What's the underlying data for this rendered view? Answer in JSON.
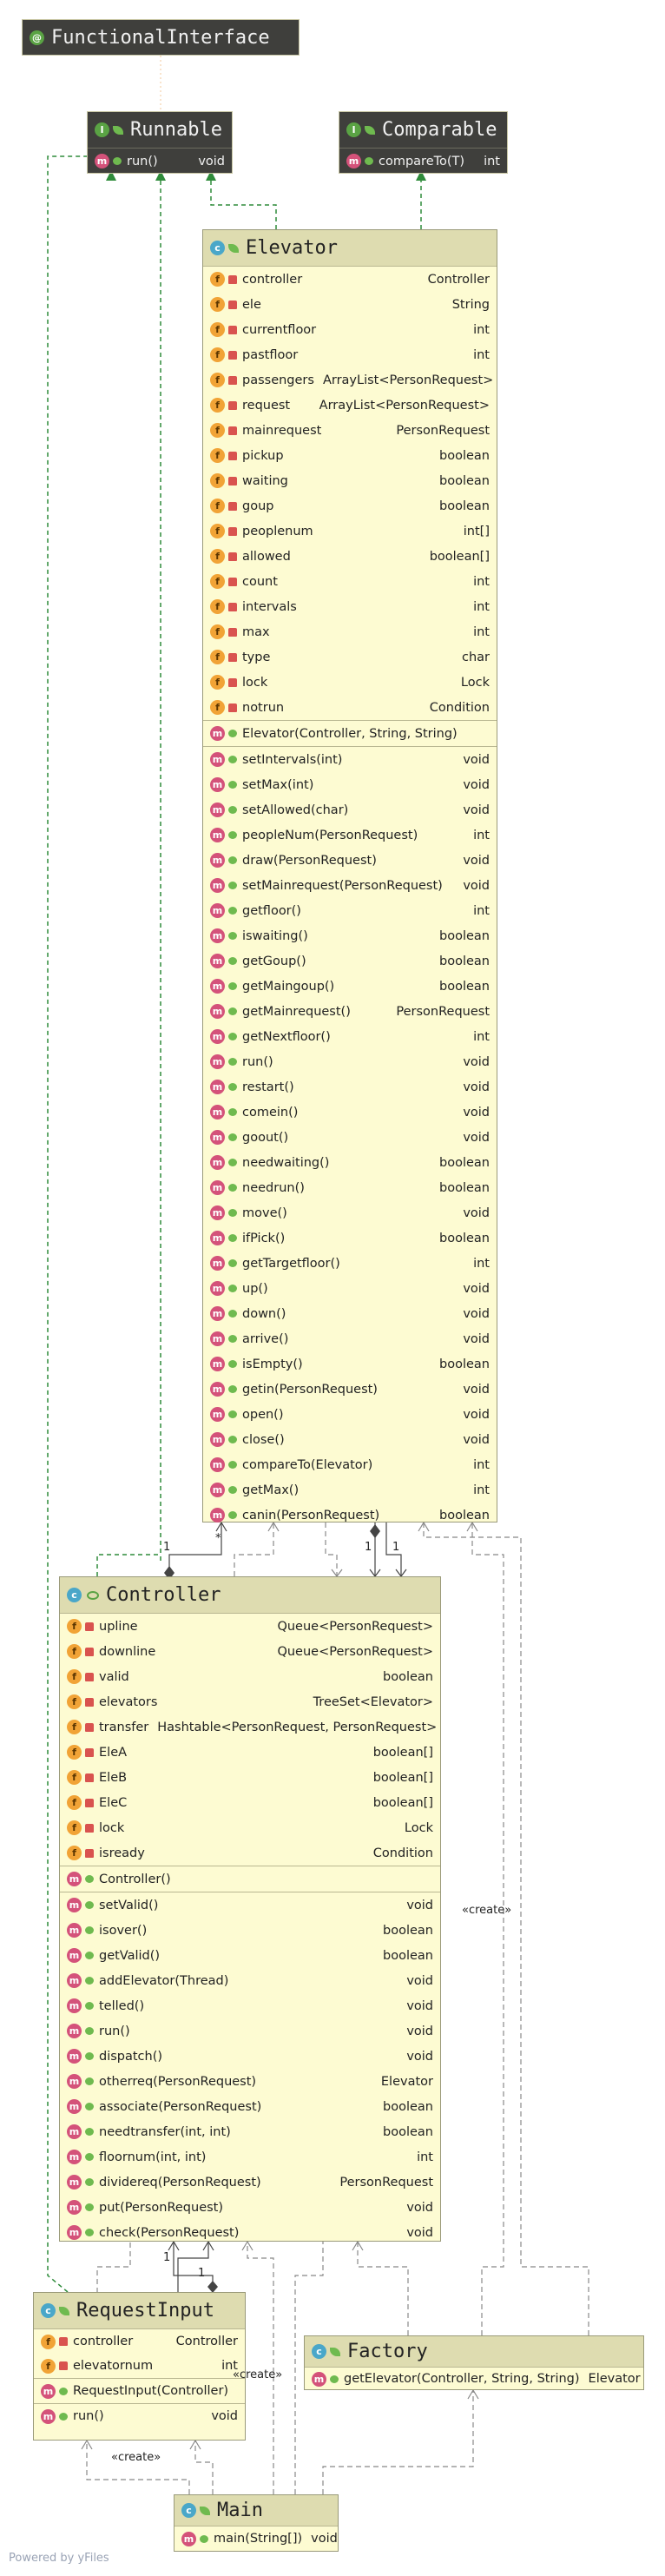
{
  "footer": "Powered by yFiles",
  "classes": {
    "functional": {
      "name": "FunctionalInterface"
    },
    "runnable": {
      "name": "Runnable",
      "methods": [
        {
          "name": "run()",
          "type": "void"
        }
      ]
    },
    "comparable": {
      "name": "Comparable",
      "methods": [
        {
          "name": "compareTo(T)",
          "type": "int"
        }
      ]
    },
    "elevator": {
      "name": "Elevator",
      "fields": [
        {
          "name": "controller",
          "type": "Controller"
        },
        {
          "name": "ele",
          "type": "String"
        },
        {
          "name": "currentfloor",
          "type": "int"
        },
        {
          "name": "pastfloor",
          "type": "int"
        },
        {
          "name": "passengers",
          "type": "ArrayList<PersonRequest>"
        },
        {
          "name": "request",
          "type": "ArrayList<PersonRequest>"
        },
        {
          "name": "mainrequest",
          "type": "PersonRequest"
        },
        {
          "name": "pickup",
          "type": "boolean"
        },
        {
          "name": "waiting",
          "type": "boolean"
        },
        {
          "name": "goup",
          "type": "boolean"
        },
        {
          "name": "peoplenum",
          "type": "int[]"
        },
        {
          "name": "allowed",
          "type": "boolean[]"
        },
        {
          "name": "count",
          "type": "int"
        },
        {
          "name": "intervals",
          "type": "int"
        },
        {
          "name": "max",
          "type": "int"
        },
        {
          "name": "type",
          "type": "char"
        },
        {
          "name": "lock",
          "type": "Lock"
        },
        {
          "name": "notrun",
          "type": "Condition"
        }
      ],
      "constructors": [
        {
          "name": "Elevator(Controller, String, String)",
          "type": ""
        }
      ],
      "methods": [
        {
          "name": "setIntervals(int)",
          "type": "void"
        },
        {
          "name": "setMax(int)",
          "type": "void"
        },
        {
          "name": "setAllowed(char)",
          "type": "void"
        },
        {
          "name": "peopleNum(PersonRequest)",
          "type": "int"
        },
        {
          "name": "draw(PersonRequest)",
          "type": "void"
        },
        {
          "name": "setMainrequest(PersonRequest)",
          "type": "void"
        },
        {
          "name": "getfloor()",
          "type": "int"
        },
        {
          "name": "iswaiting()",
          "type": "boolean"
        },
        {
          "name": "getGoup()",
          "type": "boolean"
        },
        {
          "name": "getMaingoup()",
          "type": "boolean"
        },
        {
          "name": "getMainrequest()",
          "type": "PersonRequest"
        },
        {
          "name": "getNextfloor()",
          "type": "int"
        },
        {
          "name": "run()",
          "type": "void"
        },
        {
          "name": "restart()",
          "type": "void"
        },
        {
          "name": "comein()",
          "type": "void"
        },
        {
          "name": "goout()",
          "type": "void"
        },
        {
          "name": "needwaiting()",
          "type": "boolean"
        },
        {
          "name": "needrun()",
          "type": "boolean"
        },
        {
          "name": "move()",
          "type": "void"
        },
        {
          "name": "ifPick()",
          "type": "boolean"
        },
        {
          "name": "getTargetfloor()",
          "type": "int"
        },
        {
          "name": "up()",
          "type": "void"
        },
        {
          "name": "down()",
          "type": "void"
        },
        {
          "name": "arrive()",
          "type": "void"
        },
        {
          "name": "isEmpty()",
          "type": "boolean"
        },
        {
          "name": "getin(PersonRequest)",
          "type": "void"
        },
        {
          "name": "open()",
          "type": "void"
        },
        {
          "name": "close()",
          "type": "void"
        },
        {
          "name": "compareTo(Elevator)",
          "type": "int"
        },
        {
          "name": "getMax()",
          "type": "int"
        },
        {
          "name": "canin(PersonRequest)",
          "type": "boolean"
        }
      ]
    },
    "controller": {
      "name": "Controller",
      "fields": [
        {
          "name": "upline",
          "type": "Queue<PersonRequest>"
        },
        {
          "name": "downline",
          "type": "Queue<PersonRequest>"
        },
        {
          "name": "valid",
          "type": "boolean"
        },
        {
          "name": "elevators",
          "type": "TreeSet<Elevator>"
        },
        {
          "name": "transfer",
          "type": "Hashtable<PersonRequest, PersonRequest>"
        },
        {
          "name": "EleA",
          "type": "boolean[]"
        },
        {
          "name": "EleB",
          "type": "boolean[]"
        },
        {
          "name": "EleC",
          "type": "boolean[]"
        },
        {
          "name": "lock",
          "type": "Lock"
        },
        {
          "name": "isready",
          "type": "Condition"
        }
      ],
      "constructors": [
        {
          "name": "Controller()",
          "type": ""
        }
      ],
      "methods": [
        {
          "name": "setValid()",
          "type": "void"
        },
        {
          "name": "isover()",
          "type": "boolean"
        },
        {
          "name": "getValid()",
          "type": "boolean"
        },
        {
          "name": "addElevator(Thread)",
          "type": "void"
        },
        {
          "name": "telled()",
          "type": "void"
        },
        {
          "name": "run()",
          "type": "void"
        },
        {
          "name": "dispatch()",
          "type": "void"
        },
        {
          "name": "otherreq(PersonRequest)",
          "type": "Elevator"
        },
        {
          "name": "associate(PersonRequest)",
          "type": "boolean"
        },
        {
          "name": "needtransfer(int, int)",
          "type": "boolean"
        },
        {
          "name": "floornum(int, int)",
          "type": "int"
        },
        {
          "name": "dividereq(PersonRequest)",
          "type": "PersonRequest"
        },
        {
          "name": "put(PersonRequest)",
          "type": "void"
        },
        {
          "name": "check(PersonRequest)",
          "type": "void"
        }
      ]
    },
    "requestinput": {
      "name": "RequestInput",
      "fields": [
        {
          "name": "controller",
          "type": "Controller"
        },
        {
          "name": "elevatornum",
          "type": "int"
        }
      ],
      "constructors": [
        {
          "name": "RequestInput(Controller)",
          "type": ""
        }
      ],
      "methods": [
        {
          "name": "run()",
          "type": "void"
        }
      ]
    },
    "factory": {
      "name": "Factory",
      "methods": [
        {
          "name": "getElevator(Controller, String, String)",
          "type": "Elevator"
        }
      ]
    },
    "main": {
      "name": "Main",
      "methods": [
        {
          "name": "main(String[])",
          "type": "void"
        }
      ]
    }
  },
  "edge_labels": {
    "create1": "«create»",
    "create2": "«create»",
    "create3": "«create»",
    "one_a": "1",
    "star": "*",
    "one_b": "1",
    "one_c": "1",
    "one_d": "1",
    "one_e": "1"
  }
}
